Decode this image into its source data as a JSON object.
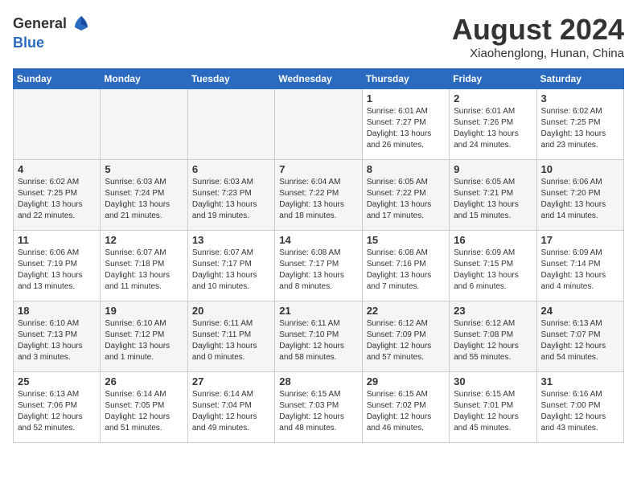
{
  "header": {
    "logo_line1": "General",
    "logo_line2": "Blue",
    "month_title": "August 2024",
    "location": "Xiaohenglong, Hunan, China"
  },
  "weekdays": [
    "Sunday",
    "Monday",
    "Tuesday",
    "Wednesday",
    "Thursday",
    "Friday",
    "Saturday"
  ],
  "weeks": [
    [
      {
        "day": "",
        "empty": true
      },
      {
        "day": "",
        "empty": true
      },
      {
        "day": "",
        "empty": true
      },
      {
        "day": "",
        "empty": true
      },
      {
        "day": "1",
        "sunrise": "6:01 AM",
        "sunset": "7:27 PM",
        "daylight": "13 hours and 26 minutes."
      },
      {
        "day": "2",
        "sunrise": "6:01 AM",
        "sunset": "7:26 PM",
        "daylight": "13 hours and 24 minutes."
      },
      {
        "day": "3",
        "sunrise": "6:02 AM",
        "sunset": "7:25 PM",
        "daylight": "13 hours and 23 minutes."
      }
    ],
    [
      {
        "day": "4",
        "sunrise": "6:02 AM",
        "sunset": "7:25 PM",
        "daylight": "13 hours and 22 minutes."
      },
      {
        "day": "5",
        "sunrise": "6:03 AM",
        "sunset": "7:24 PM",
        "daylight": "13 hours and 21 minutes."
      },
      {
        "day": "6",
        "sunrise": "6:03 AM",
        "sunset": "7:23 PM",
        "daylight": "13 hours and 19 minutes."
      },
      {
        "day": "7",
        "sunrise": "6:04 AM",
        "sunset": "7:22 PM",
        "daylight": "13 hours and 18 minutes."
      },
      {
        "day": "8",
        "sunrise": "6:05 AM",
        "sunset": "7:22 PM",
        "daylight": "13 hours and 17 minutes."
      },
      {
        "day": "9",
        "sunrise": "6:05 AM",
        "sunset": "7:21 PM",
        "daylight": "13 hours and 15 minutes."
      },
      {
        "day": "10",
        "sunrise": "6:06 AM",
        "sunset": "7:20 PM",
        "daylight": "13 hours and 14 minutes."
      }
    ],
    [
      {
        "day": "11",
        "sunrise": "6:06 AM",
        "sunset": "7:19 PM",
        "daylight": "13 hours and 13 minutes."
      },
      {
        "day": "12",
        "sunrise": "6:07 AM",
        "sunset": "7:18 PM",
        "daylight": "13 hours and 11 minutes."
      },
      {
        "day": "13",
        "sunrise": "6:07 AM",
        "sunset": "7:17 PM",
        "daylight": "13 hours and 10 minutes."
      },
      {
        "day": "14",
        "sunrise": "6:08 AM",
        "sunset": "7:17 PM",
        "daylight": "13 hours and 8 minutes."
      },
      {
        "day": "15",
        "sunrise": "6:08 AM",
        "sunset": "7:16 PM",
        "daylight": "13 hours and 7 minutes."
      },
      {
        "day": "16",
        "sunrise": "6:09 AM",
        "sunset": "7:15 PM",
        "daylight": "13 hours and 6 minutes."
      },
      {
        "day": "17",
        "sunrise": "6:09 AM",
        "sunset": "7:14 PM",
        "daylight": "13 hours and 4 minutes."
      }
    ],
    [
      {
        "day": "18",
        "sunrise": "6:10 AM",
        "sunset": "7:13 PM",
        "daylight": "13 hours and 3 minutes."
      },
      {
        "day": "19",
        "sunrise": "6:10 AM",
        "sunset": "7:12 PM",
        "daylight": "13 hours and 1 minute."
      },
      {
        "day": "20",
        "sunrise": "6:11 AM",
        "sunset": "7:11 PM",
        "daylight": "13 hours and 0 minutes."
      },
      {
        "day": "21",
        "sunrise": "6:11 AM",
        "sunset": "7:10 PM",
        "daylight": "12 hours and 58 minutes."
      },
      {
        "day": "22",
        "sunrise": "6:12 AM",
        "sunset": "7:09 PM",
        "daylight": "12 hours and 57 minutes."
      },
      {
        "day": "23",
        "sunrise": "6:12 AM",
        "sunset": "7:08 PM",
        "daylight": "12 hours and 55 minutes."
      },
      {
        "day": "24",
        "sunrise": "6:13 AM",
        "sunset": "7:07 PM",
        "daylight": "12 hours and 54 minutes."
      }
    ],
    [
      {
        "day": "25",
        "sunrise": "6:13 AM",
        "sunset": "7:06 PM",
        "daylight": "12 hours and 52 minutes."
      },
      {
        "day": "26",
        "sunrise": "6:14 AM",
        "sunset": "7:05 PM",
        "daylight": "12 hours and 51 minutes."
      },
      {
        "day": "27",
        "sunrise": "6:14 AM",
        "sunset": "7:04 PM",
        "daylight": "12 hours and 49 minutes."
      },
      {
        "day": "28",
        "sunrise": "6:15 AM",
        "sunset": "7:03 PM",
        "daylight": "12 hours and 48 minutes."
      },
      {
        "day": "29",
        "sunrise": "6:15 AM",
        "sunset": "7:02 PM",
        "daylight": "12 hours and 46 minutes."
      },
      {
        "day": "30",
        "sunrise": "6:15 AM",
        "sunset": "7:01 PM",
        "daylight": "12 hours and 45 minutes."
      },
      {
        "day": "31",
        "sunrise": "6:16 AM",
        "sunset": "7:00 PM",
        "daylight": "12 hours and 43 minutes."
      }
    ]
  ]
}
